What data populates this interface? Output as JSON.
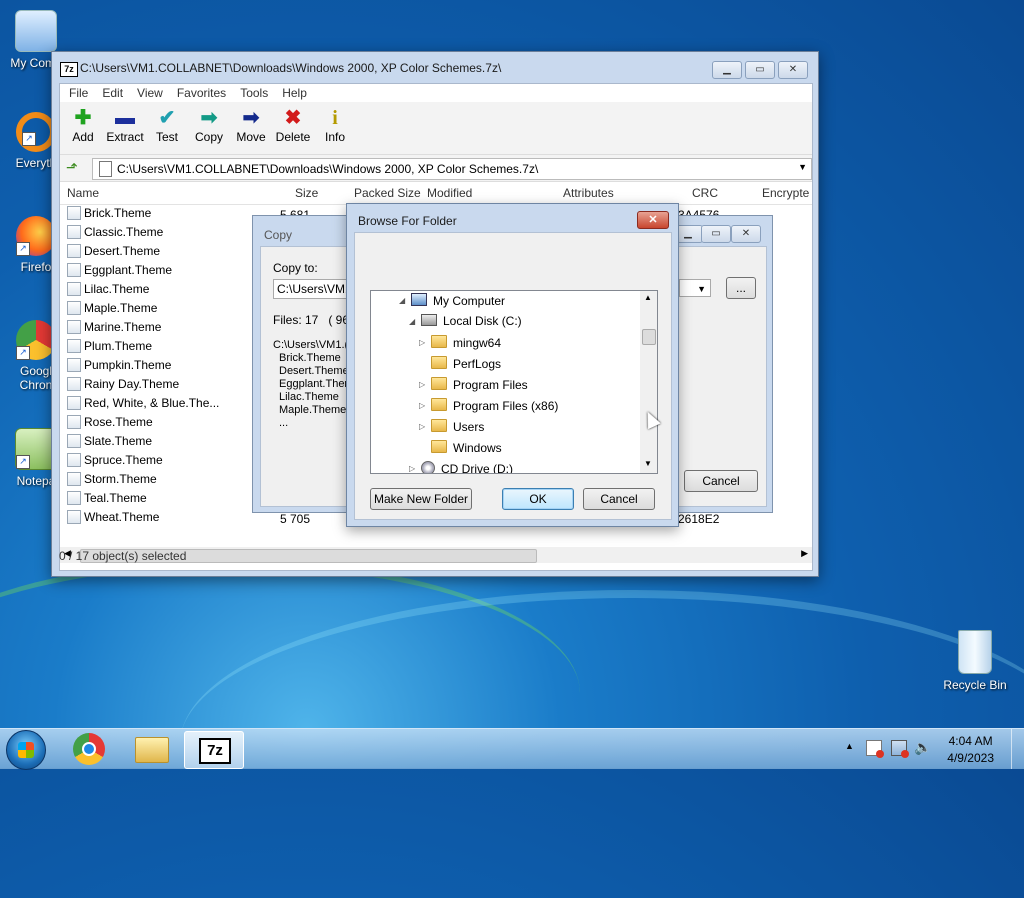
{
  "desktop": {
    "icons": [
      {
        "label": "My Comp"
      },
      {
        "label": "Everyth"
      },
      {
        "label": "Firefo"
      },
      {
        "label": "Googl\nChron"
      },
      {
        "label": "Notepa"
      },
      {
        "label": "Recycle Bin"
      }
    ]
  },
  "window": {
    "title": "C:\\Users\\VM1.COLLABNET\\Downloads\\Windows 2000, XP Color Schemes.7z\\",
    "app_icon": "7z",
    "menu": [
      "File",
      "Edit",
      "View",
      "Favorites",
      "Tools",
      "Help"
    ],
    "toolbar": [
      {
        "label": "Add",
        "icon": "plus-icon",
        "color": "#1fa31f"
      },
      {
        "label": "Extract",
        "icon": "minus-icon",
        "color": "#1c2f9c"
      },
      {
        "label": "Test",
        "icon": "check-icon",
        "color": "#20a0b0"
      },
      {
        "label": "Copy",
        "icon": "double-arrow-icon",
        "color": "#139a86"
      },
      {
        "label": "Move",
        "icon": "arrow-right-icon",
        "color": "#142a8c"
      },
      {
        "label": "Delete",
        "icon": "x-icon",
        "color": "#d21a1a"
      },
      {
        "label": "Info",
        "icon": "info-icon",
        "color": "#b49a00"
      }
    ],
    "address": "C:\\Users\\VM1.COLLABNET\\Downloads\\Windows 2000, XP Color Schemes.7z\\",
    "columns": [
      "Name",
      "Size",
      "Packed Size",
      "Modified",
      "Attributes",
      "CRC",
      "Encrypte"
    ],
    "files": [
      "Brick.Theme",
      "Classic.Theme",
      "Desert.Theme",
      "Eggplant.Theme",
      "Lilac.Theme",
      "Maple.Theme",
      "Marine.Theme",
      "Plum.Theme",
      "Pumpkin.Theme",
      "Rainy Day.Theme",
      "Red, White, & Blue.The...",
      "Rose.Theme",
      "Slate.Theme",
      "Spruce.Theme",
      "Storm.Theme",
      "Teal.Theme",
      "Wheat.Theme"
    ],
    "first_size": "5 681",
    "first_crc": "3A4576",
    "last_size": "5 705",
    "last_crc": "2618E2",
    "status": "0 / 17 object(s) selected"
  },
  "copy_dialog": {
    "title": "Copy",
    "copy_to_label": "Copy to:",
    "path": "C:\\Users\\VM1.(",
    "browse_label": "...",
    "files_line": "Files: 17   ( 96",
    "list_path": "C:\\Users\\VM1.(",
    "list_items": [
      "Brick.Theme",
      "Desert.Theme",
      "Eggplant.Ther",
      "Lilac.Theme",
      "Maple.Theme",
      "..."
    ],
    "cancel_label": "Cancel"
  },
  "browse_dialog": {
    "title": "Browse For Folder",
    "tree": [
      {
        "label": "My Computer",
        "level": 0,
        "icon": "computer-icon"
      },
      {
        "label": "Local Disk (C:)",
        "level": 1,
        "icon": "drive-icon"
      },
      {
        "label": "mingw64",
        "level": 2,
        "icon": "folder-icon"
      },
      {
        "label": "PerfLogs",
        "level": 2,
        "icon": "folder-icon"
      },
      {
        "label": "Program Files",
        "level": 2,
        "icon": "folder-icon"
      },
      {
        "label": "Program Files (x86)",
        "level": 2,
        "icon": "folder-icon"
      },
      {
        "label": "Users",
        "level": 2,
        "icon": "folder-icon"
      },
      {
        "label": "Windows",
        "level": 2,
        "icon": "folder-icon"
      },
      {
        "label": "CD Drive (D:)",
        "level": 1,
        "icon": "cd-icon"
      }
    ],
    "new_folder_label": "Make New Folder",
    "ok_label": "OK",
    "cancel_label": "Cancel"
  },
  "taskbar": {
    "time": "4:04 AM",
    "date": "4/9/2023"
  }
}
